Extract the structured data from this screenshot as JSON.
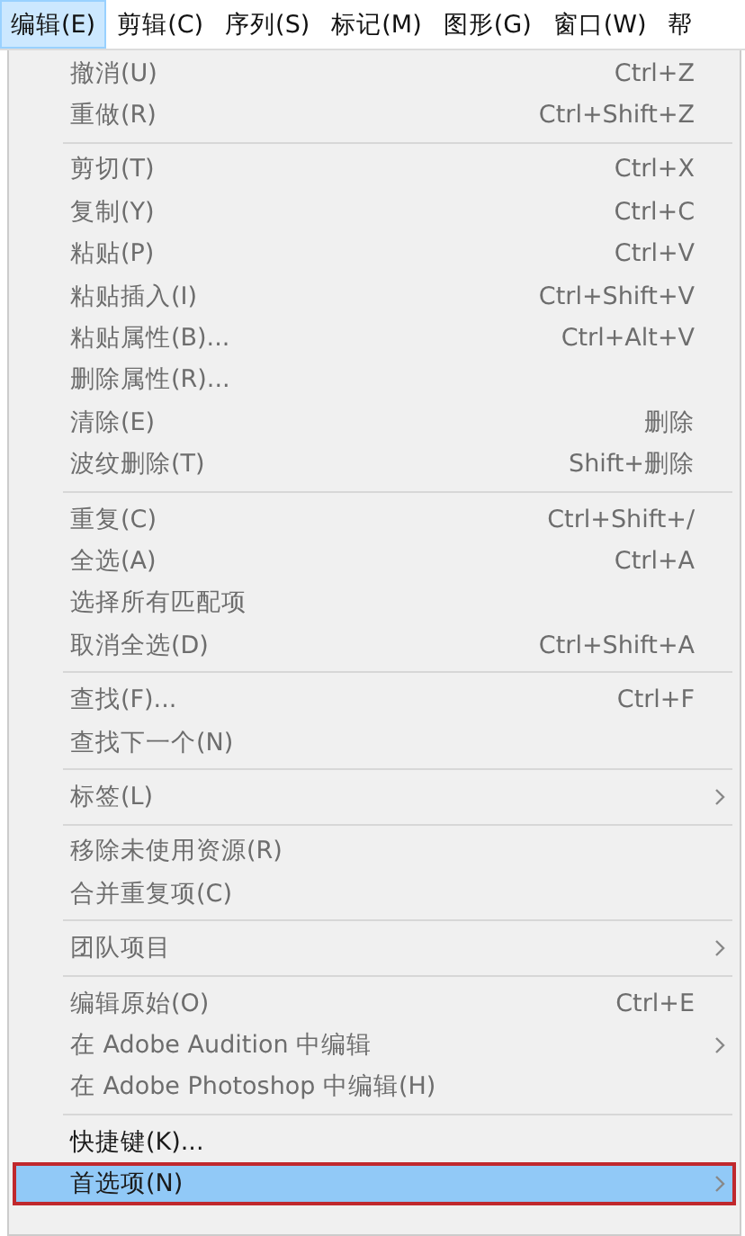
{
  "menu_bar": [
    {
      "label": "编辑(E)",
      "selected": true
    },
    {
      "label": "剪辑(C)",
      "selected": false
    },
    {
      "label": "序列(S)",
      "selected": false
    },
    {
      "label": "标记(M)",
      "selected": false
    },
    {
      "label": "图形(G)",
      "selected": false
    },
    {
      "label": "窗口(W)",
      "selected": false
    },
    {
      "label": "帮",
      "selected": false
    }
  ],
  "menu": {
    "groups": [
      [
        {
          "label": "撤消(U)",
          "shortcut": "Ctrl+Z",
          "disabled": true,
          "submenu": false,
          "selected": false
        },
        {
          "label": "重做(R)",
          "shortcut": "Ctrl+Shift+Z",
          "disabled": true,
          "submenu": false,
          "selected": false
        }
      ],
      [
        {
          "label": "剪切(T)",
          "shortcut": "Ctrl+X",
          "disabled": true,
          "submenu": false,
          "selected": false
        },
        {
          "label": "复制(Y)",
          "shortcut": "Ctrl+C",
          "disabled": true,
          "submenu": false,
          "selected": false
        },
        {
          "label": "粘贴(P)",
          "shortcut": "Ctrl+V",
          "disabled": true,
          "submenu": false,
          "selected": false
        },
        {
          "label": "粘贴插入(I)",
          "shortcut": "Ctrl+Shift+V",
          "disabled": true,
          "submenu": false,
          "selected": false
        },
        {
          "label": "粘贴属性(B)...",
          "shortcut": "Ctrl+Alt+V",
          "disabled": true,
          "submenu": false,
          "selected": false
        },
        {
          "label": "删除属性(R)...",
          "disabled": true,
          "submenu": false,
          "selected": false
        },
        {
          "label": "清除(E)",
          "shortcut": "删除",
          "disabled": true,
          "submenu": false,
          "selected": false
        },
        {
          "label": "波纹删除(T)",
          "shortcut": "Shift+删除",
          "disabled": true,
          "submenu": false,
          "selected": false
        }
      ],
      [
        {
          "label": "重复(C)",
          "shortcut": "Ctrl+Shift+/",
          "disabled": true,
          "submenu": false,
          "selected": false
        },
        {
          "label": "全选(A)",
          "shortcut": "Ctrl+A",
          "disabled": true,
          "submenu": false,
          "selected": false
        },
        {
          "label": "选择所有匹配项",
          "disabled": true,
          "submenu": false,
          "selected": false
        },
        {
          "label": "取消全选(D)",
          "shortcut": "Ctrl+Shift+A",
          "disabled": true,
          "submenu": false,
          "selected": false
        }
      ],
      [
        {
          "label": "查找(F)...",
          "shortcut": "Ctrl+F",
          "disabled": true,
          "submenu": false,
          "selected": false
        },
        {
          "label": "查找下一个(N)",
          "disabled": true,
          "submenu": false,
          "selected": false
        }
      ],
      [
        {
          "label": "标签(L)",
          "disabled": true,
          "submenu": true,
          "selected": false
        }
      ],
      [
        {
          "label": "移除未使用资源(R)",
          "disabled": true,
          "submenu": false,
          "selected": false
        },
        {
          "label": "合并重复项(C)",
          "disabled": true,
          "submenu": false,
          "selected": false
        }
      ],
      [
        {
          "label": "团队项目",
          "disabled": true,
          "submenu": true,
          "selected": false
        }
      ],
      [
        {
          "label": "编辑原始(O)",
          "shortcut": "Ctrl+E",
          "disabled": true,
          "submenu": false,
          "selected": false
        },
        {
          "label": "在 Adobe Audition 中编辑",
          "disabled": true,
          "submenu": true,
          "selected": false
        },
        {
          "label": "在 Adobe Photoshop 中编辑(H)",
          "disabled": true,
          "submenu": false,
          "selected": false
        }
      ],
      [
        {
          "label": "快捷键(K)...",
          "disabled": false,
          "submenu": false,
          "selected": false
        },
        {
          "label": "首选项(N)",
          "disabled": false,
          "submenu": true,
          "selected": true
        }
      ]
    ]
  }
}
